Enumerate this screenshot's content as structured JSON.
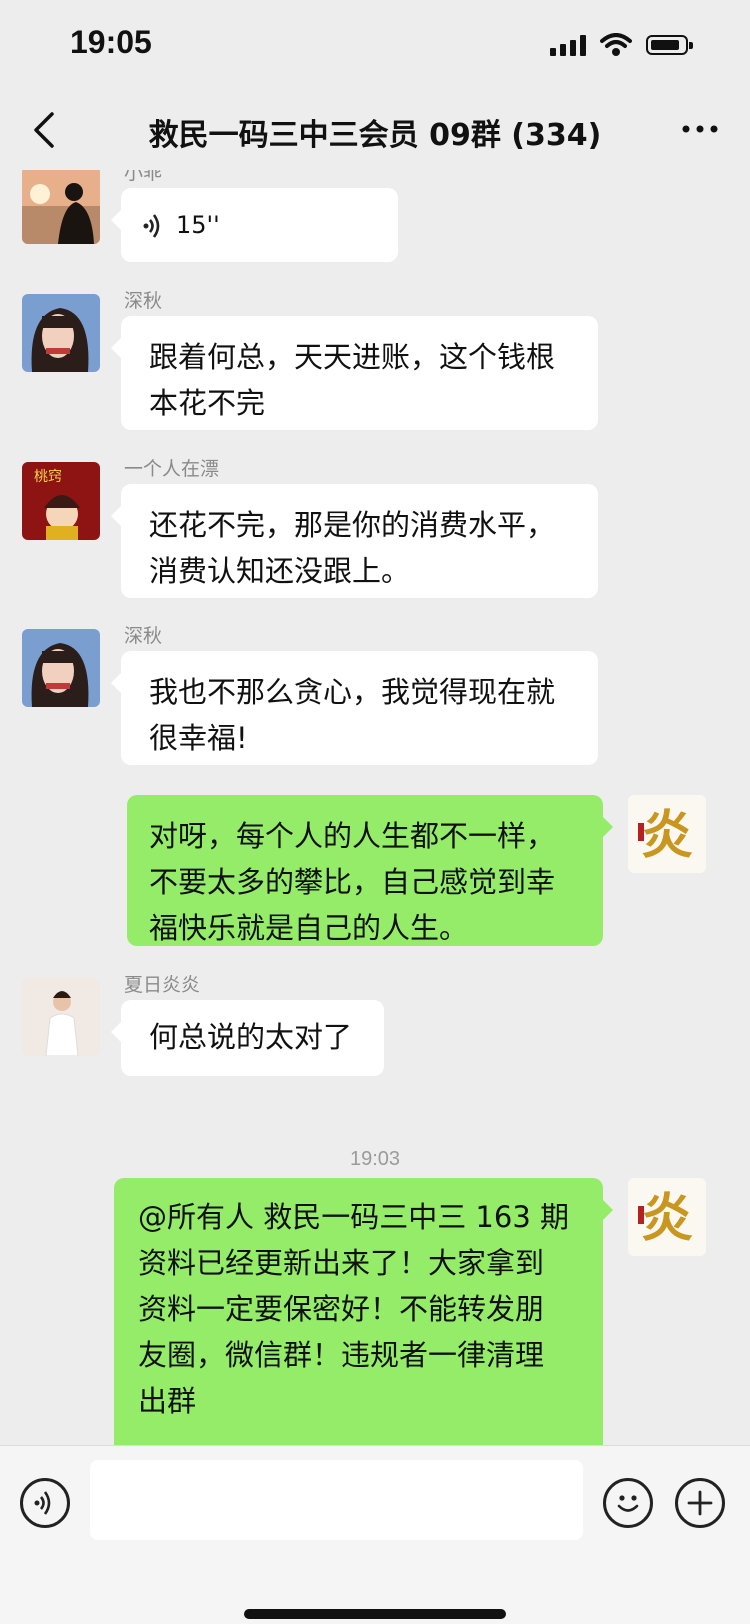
{
  "status_bar": {
    "time": "19:05"
  },
  "header": {
    "title": "救民一码三中三会员 09群 (334)"
  },
  "messages": [
    {
      "sender": "小乖",
      "type": "voice",
      "duration": "15''"
    },
    {
      "sender": "深秋",
      "text_lines": [
        "跟着何总，天天进账，这个钱根",
        "本花不完"
      ]
    },
    {
      "sender": "一个人在漂",
      "avatar_text": "桃窍",
      "text_lines": [
        "还花不完，那是你的消费水平，",
        "消费认知还没跟上。"
      ]
    },
    {
      "sender": "深秋",
      "text_lines": [
        "我也不那么贪心，我觉得现在就",
        "很幸福!"
      ]
    },
    {
      "sender": "",
      "self": true,
      "text_lines": [
        "对呀，每个人的人生都不一样，",
        "不要太多的攀比，自己感觉到幸",
        "福快乐就是自己的人生。"
      ]
    },
    {
      "sender": "夏日炎炎",
      "text_lines": [
        "何总说的太对了"
      ]
    },
    {
      "sender": "",
      "self": true,
      "text_lines": [
        "@所有人  救民一码三中三 163 期",
        "资料已经更新出来了！大家拿到",
        "资料一定要保密好！不能转发朋",
        "友圈，微信群！违规者一律清理",
        "出群"
      ]
    }
  ],
  "timestamp": "19:03",
  "self_avatar_text": "炎",
  "colors": {
    "self_bubble": "#95ec69",
    "other_bubble": "#ffffff",
    "background": "#ededed"
  }
}
